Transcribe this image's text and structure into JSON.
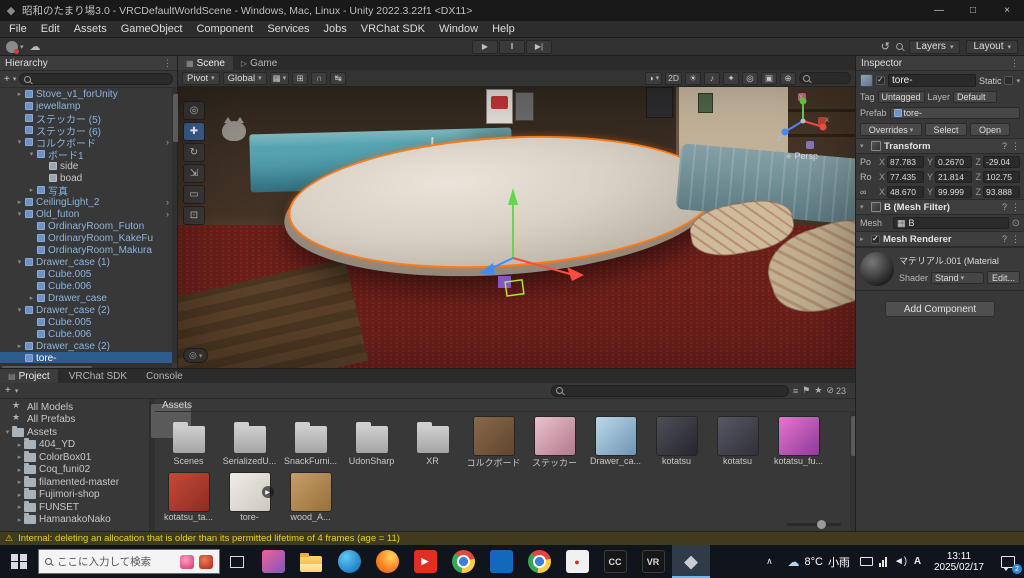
{
  "title_bar": {
    "title": "昭和のたまり場3.0 - VRCDefaultWorldScene - Windows, Mac, Linux - Unity 2022.3.22f1 <DX11>",
    "minimize": "—",
    "maximize": "□",
    "close": "×"
  },
  "menu_bar": {
    "items": [
      "File",
      "Edit",
      "Assets",
      "GameObject",
      "Component",
      "Services",
      "Jobs",
      "VRChat SDK",
      "Window",
      "Help"
    ]
  },
  "toolbar": {
    "play_icon": "▶",
    "pause_icon": "‖",
    "step_icon": "▶|",
    "history_icon": "↺",
    "layers_label": "Layers",
    "layout_label": "Layout",
    "caret": "▾",
    "cloud_icon": "☁"
  },
  "hierarchy": {
    "title": "Hierarchy",
    "menu_icon": "⋮",
    "add_label": "+",
    "items": [
      {
        "label": "Stove_v1_forUnity",
        "indent": 1,
        "arrow": "▸",
        "chev": "",
        "cls": ""
      },
      {
        "label": "jewellamp",
        "indent": 1,
        "arrow": "",
        "chev": "",
        "cls": ""
      },
      {
        "label": "ステッカー (5)",
        "indent": 1,
        "arrow": "",
        "chev": "",
        "cls": ""
      },
      {
        "label": "ステッカー (6)",
        "indent": 1,
        "arrow": "",
        "chev": "",
        "cls": ""
      },
      {
        "label": "コルクボード",
        "indent": 1,
        "arrow": "▾",
        "chev": "›",
        "cls": ""
      },
      {
        "label": "ボード1",
        "indent": 2,
        "arrow": "▾",
        "chev": "",
        "cls": ""
      },
      {
        "label": "side",
        "indent": 3,
        "arrow": "",
        "chev": "",
        "cls": "plain"
      },
      {
        "label": "boad",
        "indent": 3,
        "arrow": "",
        "chev": "",
        "cls": "plain"
      },
      {
        "label": "写真",
        "indent": 2,
        "arrow": "▸",
        "chev": "",
        "cls": ""
      },
      {
        "label": "CeilingLight_2",
        "indent": 1,
        "arrow": "▸",
        "chev": "›",
        "cls": ""
      },
      {
        "label": "Old_futon",
        "indent": 1,
        "arrow": "▾",
        "chev": "›",
        "cls": ""
      },
      {
        "label": "OrdinaryRoom_Futon",
        "indent": 2,
        "arrow": "",
        "chev": "",
        "cls": ""
      },
      {
        "label": "OrdinaryRoom_KakeFu",
        "indent": 2,
        "arrow": "",
        "chev": "",
        "cls": ""
      },
      {
        "label": "OrdinaryRoom_Makura",
        "indent": 2,
        "arrow": "",
        "chev": "",
        "cls": ""
      },
      {
        "label": "Drawer_case (1)",
        "indent": 1,
        "arrow": "▾",
        "chev": "",
        "cls": ""
      },
      {
        "label": "Cube.005",
        "indent": 2,
        "arrow": "",
        "chev": "",
        "cls": ""
      },
      {
        "label": "Cube.006",
        "indent": 2,
        "arrow": "",
        "chev": "",
        "cls": ""
      },
      {
        "label": "Drawer_case",
        "indent": 2,
        "arrow": "▸",
        "chev": "",
        "cls": ""
      },
      {
        "label": "Drawer_case (2)",
        "indent": 1,
        "arrow": "▾",
        "chev": "",
        "cls": ""
      },
      {
        "label": "Cube.005",
        "indent": 2,
        "arrow": "",
        "chev": "",
        "cls": ""
      },
      {
        "label": "Cube.006",
        "indent": 2,
        "arrow": "",
        "chev": "",
        "cls": ""
      },
      {
        "label": "Drawer_case (2)",
        "indent": 1,
        "arrow": "▸",
        "chev": "",
        "cls": ""
      },
      {
        "label": "tore-",
        "indent": 1,
        "arrow": "",
        "chev": "",
        "cls": "sel"
      }
    ]
  },
  "scene": {
    "tabs": [
      {
        "label": "Scene",
        "icon": "▦",
        "cls": "active"
      },
      {
        "label": "Game",
        "icon": "▷",
        "cls": ""
      }
    ],
    "toolbar": {
      "pivot": "Pivot",
      "global": "Global",
      "caret": "▾",
      "grid_icon": "▦",
      "snap_icon": "⊞",
      "magnet_icon": "∩",
      "ruler_icon": "↹"
    },
    "overlay": {
      "render_icon": "◑",
      "two_d": "2D",
      "light_icon": "☀",
      "audio_icon": "♪",
      "fx_icon": "✦",
      "vis_icon": "◎",
      "cam_icon": "▣",
      "gizmos_icon": "⊕"
    },
    "tools": {
      "view": "◎",
      "move": "✚",
      "rotate": "↻",
      "scale": "⇲",
      "rect": "▭",
      "transform": "⊡"
    },
    "camera_overlay_icon": "◎",
    "persp_icon": "◆",
    "persp_label": "Persp",
    "axis": {
      "x": "X",
      "y": "Y",
      "z": "Z"
    }
  },
  "inspector": {
    "title": "Inspector",
    "icons": {
      "open": "▾",
      "closed": "▸",
      "help": "?",
      "menu": "⋮",
      "picker": "⊙",
      "mesh": "▦"
    },
    "name": "tore-",
    "static_label": "Static",
    "tag_label": "Tag",
    "tag_value": "Untagged",
    "layer_label": "Layer",
    "layer_value": "Default",
    "prefab_label": "Prefab",
    "prefab_value": "tore-",
    "overrides_label": "Overrides",
    "select_label": "Select",
    "open_label": "Open",
    "transform": {
      "title": "Transform",
      "axis_x": "X",
      "axis_y": "Y",
      "axis_z": "Z",
      "rows": [
        {
          "label": "Po",
          "x": "87.783",
          "y": "0.2670",
          "z": "-29.04"
        },
        {
          "label": "Ro",
          "x": "77.435",
          "y": "21.814",
          "z": "102.75"
        },
        {
          "label": "∞",
          "x": "48.670",
          "y": "99.999",
          "z": "93.888"
        }
      ]
    },
    "mesh_filter": {
      "title": "B (Mesh Filter)",
      "mesh_label": "Mesh",
      "mesh_value": "B"
    },
    "mesh_renderer": {
      "title": "Mesh Renderer"
    },
    "material": {
      "name": "マテリアル.001 (Material",
      "shader_label": "Shader",
      "shader_value": "Stand",
      "edit_label": "Edit..."
    },
    "add_component_label": "Add Component"
  },
  "project": {
    "tabs": [
      {
        "label": "Project",
        "icon": "▤",
        "cls": "active"
      },
      {
        "label": "VRChat SDK",
        "icon": "",
        "cls": ""
      },
      {
        "label": "Console",
        "icon": "",
        "cls": ""
      }
    ],
    "add_label": "+",
    "caret": "▾",
    "icons": {
      "type": "≡",
      "label": "⚑",
      "fav": "★",
      "hidden": "⊘"
    },
    "hidden_count": "23",
    "breadcrumb": "Assets",
    "folders": [
      {
        "label": "All Models",
        "indent": 0,
        "arrow": "",
        "cls": "star"
      },
      {
        "label": "All Prefabs",
        "indent": 0,
        "arrow": "",
        "cls": "star"
      },
      {
        "label": "Assets",
        "indent": 0,
        "arrow": "▾",
        "cls": "fold"
      },
      {
        "label": "404_YD",
        "indent": 1,
        "arrow": "▸",
        "cls": "fold"
      },
      {
        "label": "ColorBox01",
        "indent": 1,
        "arrow": "▸",
        "cls": "fold"
      },
      {
        "label": "Coq_funi02",
        "indent": 1,
        "arrow": "▸",
        "cls": "fold"
      },
      {
        "label": "filamented-master",
        "indent": 1,
        "arrow": "▸",
        "cls": "fold"
      },
      {
        "label": "Fujimori-shop",
        "indent": 1,
        "arrow": "▸",
        "cls": "fold"
      },
      {
        "label": "FUNSET",
        "indent": 1,
        "arrow": "▸",
        "cls": "fold"
      },
      {
        "label": "HamanakoNako",
        "indent": 1,
        "arrow": "▸",
        "cls": "fold"
      }
    ],
    "assets": [
      {
        "label": "Scenes",
        "cls": "folder",
        "badge": ""
      },
      {
        "label": "SerializedU...",
        "cls": "folder",
        "badge": ""
      },
      {
        "label": "SnackFurni...",
        "cls": "folder",
        "badge": ""
      },
      {
        "label": "UdonSharp",
        "cls": "folder",
        "badge": ""
      },
      {
        "label": "XR",
        "cls": "folder",
        "badge": ""
      },
      {
        "label": "コルクボード",
        "cls": "tex",
        "bg": "linear-gradient(135deg,#8a6848,#5f4630)",
        "badge": ""
      },
      {
        "label": "ステッカー",
        "cls": "tex",
        "bg": "linear-gradient(135deg,#e8c3cd,#b4788c)",
        "badge": ""
      },
      {
        "label": "Drawer_ca...",
        "cls": "tex",
        "bg": "linear-gradient(135deg,#bcd8e8,#6e94b4)",
        "badge": ""
      },
      {
        "label": "kotatsu",
        "cls": "tex",
        "bg": "linear-gradient(135deg,#4e4e58,#26262e)",
        "badge": ""
      },
      {
        "label": "kotatsu",
        "cls": "tex",
        "bg": "linear-gradient(135deg,#585864,#30303a)",
        "badge": ""
      },
      {
        "label": "kotatsu_fu...",
        "cls": "tex",
        "bg": "linear-gradient(135deg,#e875cc,#8c3a9c)",
        "badge": ""
      },
      {
        "label": "kotatsu_ta...",
        "cls": "tex",
        "bg": "linear-gradient(135deg,#c44a38,#8e2c22)",
        "badge": ""
      },
      {
        "label": "tore-",
        "cls": "tex",
        "bg": "linear-gradient(135deg,#efede7,#ccc8bf)",
        "badge": "▶"
      },
      {
        "label": "wood_A...",
        "cls": "tex",
        "bg": "linear-gradient(135deg,#c89e66,#96703e)",
        "badge": ""
      }
    ]
  },
  "status_bar": {
    "icon": "⚠",
    "message": "Internal: deleting an allocation that is older than its permitted lifetime of 4 frames (age = 11)"
  },
  "taskbar": {
    "search_placeholder": "ここに入力して検索",
    "apps": [
      {
        "name": "paint-app",
        "cls": "",
        "cls2": "app-sq",
        "bg": "linear-gradient(135deg,#f06292,#7e57c2)",
        "glyph": "",
        "fg": "#fff"
      },
      {
        "name": "file-explorer",
        "cls": "",
        "cls2": "app-folder",
        "glyph": ""
      },
      {
        "name": "edge",
        "cls": "",
        "cls2": "app-circle",
        "bg": "radial-gradient(circle at 35% 30%,#5ec9f2,#0c63b6)",
        "glyph": ""
      },
      {
        "name": "firefox",
        "cls": "",
        "cls2": "app-circle",
        "bg": "radial-gradient(circle at 65% 28%,#ffd75e,#ff8a2b 50%,#e25a0c)",
        "glyph": ""
      },
      {
        "name": "youtube",
        "cls": "",
        "cls2": "app-sq",
        "bg": "#e12d23",
        "glyph": "▶",
        "fg": "#fff"
      },
      {
        "name": "chrome",
        "cls": "",
        "cls2": "app-chrome",
        "glyph": ""
      },
      {
        "name": "vscode",
        "cls": "",
        "cls2": "app-sq",
        "bg": "#1468bc",
        "glyph": "",
        "fg": "#fff"
      },
      {
        "name": "chrome-2",
        "cls": "",
        "cls2": "app-chrome",
        "glyph": ""
      },
      {
        "name": "media-app",
        "cls": "",
        "cls2": "app-sq",
        "bg": "#f0f0f0",
        "glyph": "●",
        "fg": "#d22f27"
      },
      {
        "name": "creative-cloud",
        "cls": "",
        "cls2": "app-dark",
        "glyph": "CC",
        "fg": "#ddd"
      },
      {
        "name": "steamvr",
        "cls": "",
        "cls2": "app-dark",
        "glyph": "VR",
        "fg": "#ddd"
      },
      {
        "name": "unity",
        "cls": "active",
        "cls2": "app-unity",
        "glyph": "◆",
        "fg": "#c9ced4"
      }
    ],
    "tray": {
      "caret": "∧",
      "weather_icon": "☁",
      "weather_temp": "8°C",
      "weather_desc": "小雨",
      "volume_icon": "◄)",
      "ime": "A",
      "time": "13:11",
      "date": "2025/02/17",
      "notif_count": "2"
    }
  }
}
